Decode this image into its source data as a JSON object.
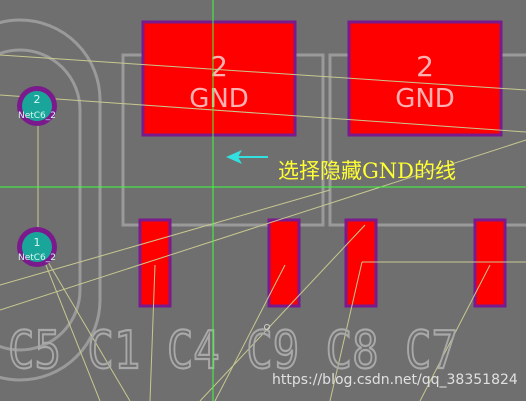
{
  "pads_top": [
    {
      "number": "2",
      "net": "GND"
    },
    {
      "number": "2",
      "net": "GND"
    }
  ],
  "vias": [
    {
      "number": "2",
      "net": "NetC6_2"
    },
    {
      "number": "1",
      "net": "NetC6_2"
    }
  ],
  "annotation": {
    "text": "选择隐藏GND的线"
  },
  "silkscreen": {
    "text": "C5 C1 C4 C9 C8 C7"
  },
  "watermark": {
    "text": "https://blog.csdn.net/qq_38351824"
  },
  "colors": {
    "board": "#6f6f6f",
    "pad_fill": "#ff0000",
    "pad_outline": "#7a1a8c",
    "crosshair": "#3dff3d",
    "ratsnest": "#c8c890",
    "silkscreen": "#a8a8a8",
    "annotation": "#ffff33",
    "arrow": "#33e0e0",
    "via": "#1aa59a"
  }
}
